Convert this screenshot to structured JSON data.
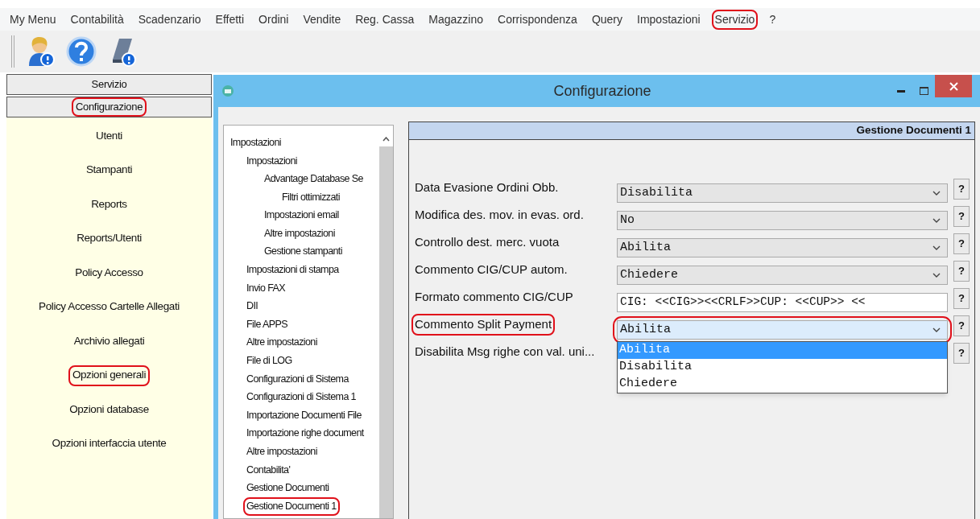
{
  "menu_bar": [
    {
      "label": "My Menu",
      "highlighted": false
    },
    {
      "label": "Contabilità",
      "highlighted": false
    },
    {
      "label": "Scadenzario",
      "highlighted": false
    },
    {
      "label": "Effetti",
      "highlighted": false
    },
    {
      "label": "Ordini",
      "highlighted": false
    },
    {
      "label": "Vendite",
      "highlighted": false
    },
    {
      "label": "Reg. Cassa",
      "highlighted": false
    },
    {
      "label": "Magazzino",
      "highlighted": false
    },
    {
      "label": "Corrispondenza",
      "highlighted": false
    },
    {
      "label": "Query",
      "highlighted": false
    },
    {
      "label": "Impostazioni",
      "highlighted": false
    },
    {
      "label": "Servizio",
      "highlighted": true
    },
    {
      "label": "?",
      "highlighted": false
    }
  ],
  "sidebar": {
    "headers": [
      {
        "label": "Servizio",
        "highlighted": false
      },
      {
        "label": "Configurazione",
        "highlighted": true
      }
    ],
    "items": [
      {
        "label": "Utenti",
        "highlighted": false
      },
      {
        "label": "Stampanti",
        "highlighted": false
      },
      {
        "label": "Reports",
        "highlighted": false
      },
      {
        "label": "Reports/Utenti",
        "highlighted": false
      },
      {
        "label": "Policy Accesso",
        "highlighted": false
      },
      {
        "label": "Policy Accesso Cartelle Allegati",
        "highlighted": false
      },
      {
        "label": "Archivio allegati",
        "highlighted": false
      },
      {
        "label": "Opzioni generali",
        "highlighted": true
      },
      {
        "label": "Opzioni database",
        "highlighted": false
      },
      {
        "label": "Opzioni interfaccia utente",
        "highlighted": false
      }
    ]
  },
  "dialog": {
    "title": "Configurazione",
    "tree": [
      {
        "label": "Impostazioni",
        "highlighted": false,
        "children": [
          {
            "label": "Impostazioni",
            "highlighted": false,
            "children": [
              {
                "label": "Advantage Database Se",
                "highlighted": false,
                "children": [
                  {
                    "label": "Filtri ottimizzati",
                    "highlighted": false
                  }
                ]
              },
              {
                "label": "Impostazioni email",
                "highlighted": false
              },
              {
                "label": "Altre impostazioni",
                "highlighted": false
              },
              {
                "label": "Gestione stampanti",
                "highlighted": false
              }
            ]
          },
          {
            "label": "Impostazioni di stampa",
            "highlighted": false
          },
          {
            "label": "Invio FAX",
            "highlighted": false
          },
          {
            "label": "DII",
            "highlighted": false
          },
          {
            "label": "File APPS",
            "highlighted": false
          },
          {
            "label": "Altre impostazioni",
            "highlighted": false
          },
          {
            "label": "File di LOG",
            "highlighted": false
          },
          {
            "label": "Configurazioni di Sistema",
            "highlighted": false
          },
          {
            "label": "Configurazioni di Sistema 1",
            "highlighted": false
          },
          {
            "label": "Importazione Documenti File",
            "highlighted": false
          },
          {
            "label": "Importazione righe document",
            "highlighted": false
          },
          {
            "label": "Altre impostazioni",
            "highlighted": false
          },
          {
            "label": "Contabilita'",
            "highlighted": false
          },
          {
            "label": "Gestione Documenti",
            "highlighted": false
          },
          {
            "label": "Gestione Documenti 1",
            "highlighted": true
          }
        ]
      }
    ],
    "panel_title": "Gestione Documenti 1",
    "settings": [
      {
        "label": "Data Evasione Ordini Obb.",
        "kind": "combo",
        "value": "Disabilita",
        "highlighted": false,
        "help": "?"
      },
      {
        "label": "Modifica des. mov. in evas. ord.",
        "kind": "combo",
        "value": "No",
        "highlighted": false,
        "help": "?"
      },
      {
        "label": "Controllo dest. merc. vuota",
        "kind": "combo",
        "value": "Abilita",
        "highlighted": false,
        "help": "?"
      },
      {
        "label": "Commento CIG/CUP autom.",
        "kind": "combo",
        "value": "Chiedere",
        "highlighted": false,
        "help": "?"
      },
      {
        "label": "Formato commento CIG/CUP",
        "kind": "text",
        "value": "CIG: <<CIG>><<CRLF>>CUP: <<CUP>> <<",
        "highlighted": false,
        "help": "?"
      },
      {
        "label": "Commento Split Payment",
        "kind": "combo",
        "value": "Abilita",
        "highlighted": true,
        "help": "?",
        "open": true,
        "options": [
          {
            "label": "Abilita",
            "selected": true
          },
          {
            "label": "Disabilita",
            "selected": false
          },
          {
            "label": "Chiedere",
            "selected": false
          }
        ]
      },
      {
        "label": "Disabilita Msg righe con val. uni...",
        "kind": "combo",
        "highlighted": false,
        "help": "?"
      }
    ]
  }
}
